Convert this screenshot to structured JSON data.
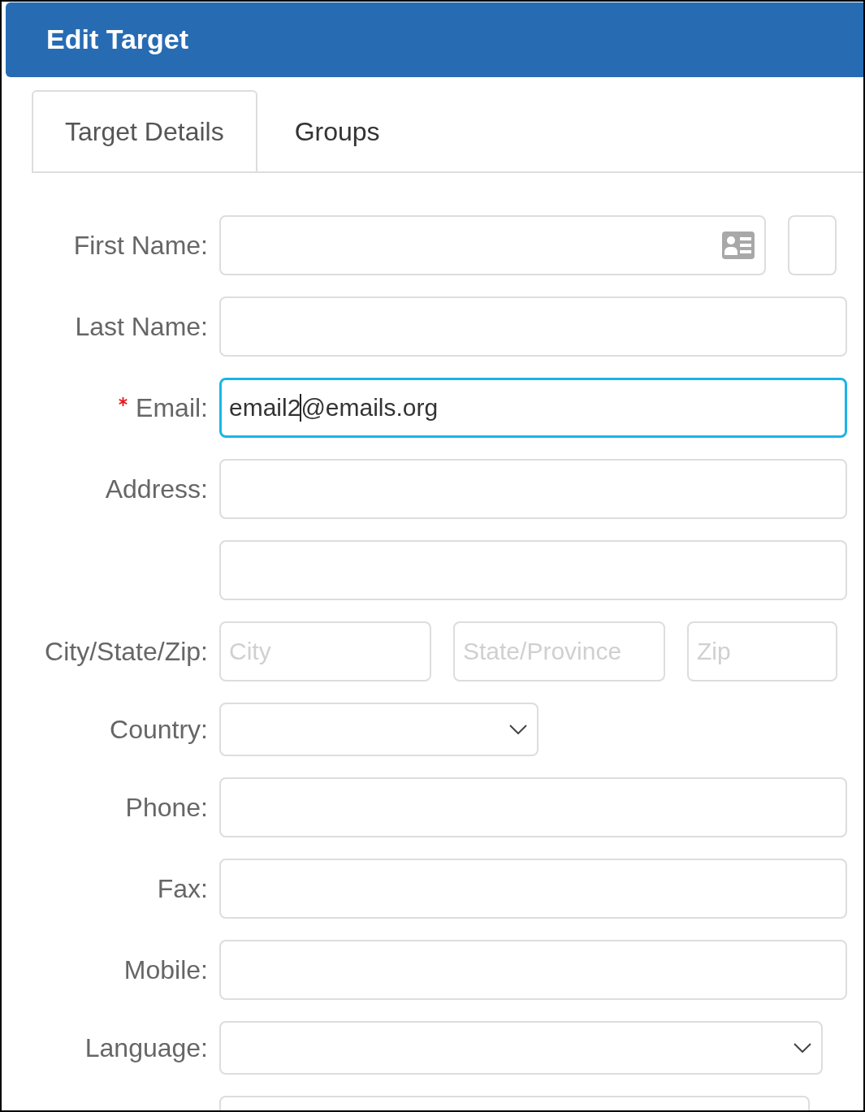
{
  "window": {
    "title": "Edit Target"
  },
  "tabs": [
    {
      "label": "Target Details",
      "selected": true
    },
    {
      "label": "Groups",
      "selected": false
    }
  ],
  "form": [
    {
      "label": "First Name:",
      "required": false,
      "cut_off": false,
      "fields": [
        {
          "kind": "card-text",
          "focused": false
        },
        {
          "kind": "square",
          "focused": false
        }
      ]
    },
    {
      "label": "Last Name:",
      "required": false,
      "cut_off": false,
      "fields": [
        {
          "kind": "text",
          "focused": false
        }
      ]
    },
    {
      "label": "Email:",
      "required": true,
      "cut_off": false,
      "fields": [
        {
          "kind": "text",
          "focused": true,
          "value_before_cursor": "email2",
          "value_after_cursor": "@emails.org"
        }
      ]
    },
    {
      "label": "Address:",
      "required": false,
      "cut_off": false,
      "fields": [
        {
          "kind": "text",
          "focused": false
        }
      ]
    },
    {
      "required": false,
      "cut_off": false,
      "fields": [
        {
          "kind": "text",
          "focused": false
        }
      ]
    },
    {
      "label": "City/State/Zip:",
      "required": false,
      "cut_off": false,
      "fields": [
        {
          "kind": "third",
          "focused": false,
          "placeholder": "City"
        },
        {
          "kind": "third",
          "focused": false,
          "placeholder": "State/Province"
        },
        {
          "kind": "zip",
          "focused": false,
          "placeholder": "Zip"
        }
      ]
    },
    {
      "label": "Country:",
      "required": false,
      "cut_off": false,
      "fields": [
        {
          "kind": "short-dropdown",
          "focused": false
        }
      ]
    },
    {
      "label": "Phone:",
      "required": false,
      "cut_off": false,
      "fields": [
        {
          "kind": "text",
          "focused": false
        }
      ]
    },
    {
      "label": "Fax:",
      "required": false,
      "cut_off": false,
      "fields": [
        {
          "kind": "text",
          "focused": false
        }
      ]
    },
    {
      "label": "Mobile:",
      "required": false,
      "cut_off": false,
      "fields": [
        {
          "kind": "text",
          "focused": false
        }
      ]
    },
    {
      "label": "Language:",
      "required": false,
      "cut_off": false,
      "fields": [
        {
          "kind": "dropdown",
          "focused": false
        }
      ]
    },
    {
      "required": false,
      "cut_off": true,
      "fields": [
        {
          "kind": "text",
          "focused": false
        }
      ]
    }
  ]
}
